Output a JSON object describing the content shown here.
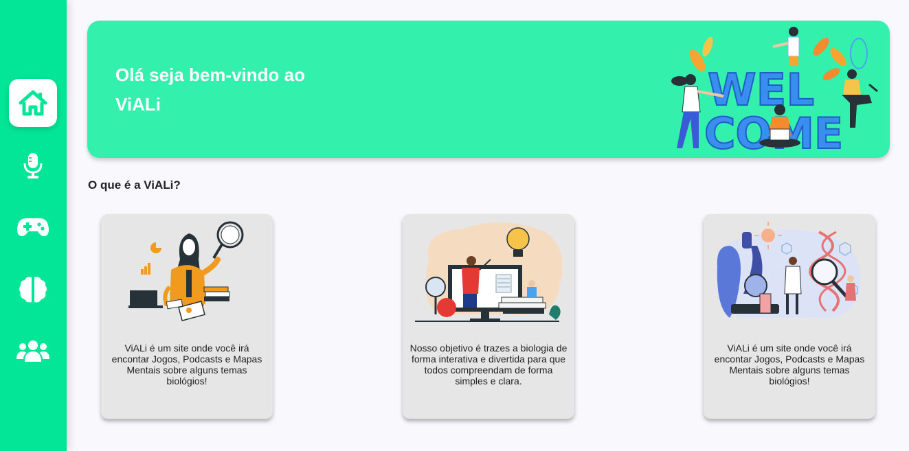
{
  "sidebar": {
    "items": [
      {
        "icon": "home-icon",
        "active": true
      },
      {
        "icon": "microphone-icon",
        "active": false
      },
      {
        "icon": "gamepad-icon",
        "active": false
      },
      {
        "icon": "brain-icon",
        "active": false
      },
      {
        "icon": "users-icon",
        "active": false
      }
    ]
  },
  "colors": {
    "sidebar": "#03e597",
    "banner": "#33f0ad",
    "card": "#e6e6e6",
    "background": "#f8f8fd"
  },
  "banner": {
    "title": "Olá seja bem-vindo ao ViALi",
    "art_text_line1": "WEL",
    "art_text_line2": "COME"
  },
  "section": {
    "title": "O que é a ViALi?"
  },
  "cards": [
    {
      "text": "ViALi é um site onde você irá encontar Jogos, Podcasts e Mapas Mentais sobre alguns temas biológios!",
      "illustration": "woman-magnifier-illustration"
    },
    {
      "text": "Nosso objetivo é trazes a biologia de forma interativa e divertida para que todos compreendam de forma simples e clara.",
      "illustration": "teacher-computer-illustration"
    },
    {
      "text": "ViALi é um site onde você irá encontar Jogos, Podcasts e Mapas Mentais sobre alguns temas biológios!",
      "illustration": "science-lab-illustration"
    }
  ]
}
